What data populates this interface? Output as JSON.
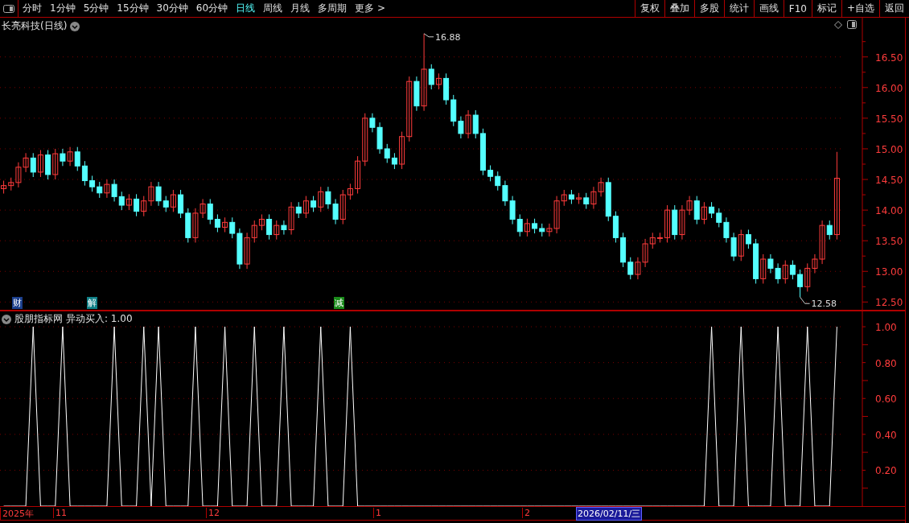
{
  "toolbar": {
    "periods": [
      {
        "label": "分时",
        "selected": false
      },
      {
        "label": "1分钟",
        "selected": false
      },
      {
        "label": "5分钟",
        "selected": false
      },
      {
        "label": "15分钟",
        "selected": false
      },
      {
        "label": "30分钟",
        "selected": false
      },
      {
        "label": "60分钟",
        "selected": false
      },
      {
        "label": "日线",
        "selected": true
      },
      {
        "label": "周线",
        "selected": false
      },
      {
        "label": "月线",
        "selected": false
      },
      {
        "label": "多周期",
        "selected": false
      },
      {
        "label": "更多 >",
        "selected": false
      }
    ],
    "buttons": [
      "复权",
      "叠加",
      "多股",
      "统计",
      "画线",
      "F10",
      "标记",
      "+自选",
      "返回"
    ]
  },
  "price_panel": {
    "title": "长亮科技(日线)",
    "chart_data": {
      "type": "candlestick",
      "grid": true,
      "ylim": [
        12.36,
        17.14
      ],
      "yticks": [
        {
          "value": 12.5,
          "label": "12.50"
        },
        {
          "value": 13,
          "label": "13.00"
        },
        {
          "value": 13.5,
          "label": "13.50"
        },
        {
          "value": 14,
          "label": "14.00"
        },
        {
          "value": 14.5,
          "label": "14.50"
        },
        {
          "value": 15,
          "label": "15.00"
        },
        {
          "value": 15.5,
          "label": "15.50"
        },
        {
          "value": 16,
          "label": "16.00"
        },
        {
          "value": 16.5,
          "label": "16.50"
        }
      ],
      "ohlc": [
        [
          14.35,
          14.48,
          14.27,
          14.4
        ],
        [
          14.4,
          14.53,
          14.32,
          14.45
        ],
        [
          14.45,
          14.78,
          14.37,
          14.7
        ],
        [
          14.7,
          14.93,
          14.62,
          14.85
        ],
        [
          14.85,
          14.93,
          14.54,
          14.62
        ],
        [
          14.62,
          14.98,
          14.54,
          14.9
        ],
        [
          14.9,
          14.98,
          14.5,
          14.58
        ],
        [
          14.58,
          15.0,
          14.5,
          14.92
        ],
        [
          14.92,
          15.0,
          14.72,
          14.8
        ],
        [
          14.8,
          15.03,
          14.72,
          14.95
        ],
        [
          14.95,
          15.03,
          14.64,
          14.72
        ],
        [
          14.72,
          14.8,
          14.4,
          14.48
        ],
        [
          14.48,
          14.56,
          14.3,
          14.38
        ],
        [
          14.38,
          14.46,
          14.2,
          14.28
        ],
        [
          14.28,
          14.5,
          14.2,
          14.42
        ],
        [
          14.42,
          14.5,
          14.14,
          14.22
        ],
        [
          14.22,
          14.3,
          14.0,
          14.08
        ],
        [
          14.08,
          14.26,
          14.0,
          14.18
        ],
        [
          14.18,
          14.26,
          13.9,
          13.98
        ],
        [
          13.98,
          14.23,
          13.9,
          14.15
        ],
        [
          14.15,
          14.46,
          14.07,
          14.38
        ],
        [
          14.38,
          14.46,
          14.07,
          14.15
        ],
        [
          14.15,
          14.23,
          13.97,
          14.05
        ],
        [
          14.05,
          14.33,
          13.97,
          14.25
        ],
        [
          14.25,
          14.33,
          13.87,
          13.95
        ],
        [
          13.95,
          14.03,
          13.47,
          13.55
        ],
        [
          13.55,
          14.03,
          13.47,
          13.95
        ],
        [
          13.95,
          14.18,
          13.87,
          14.1
        ],
        [
          14.1,
          14.18,
          13.77,
          13.85
        ],
        [
          13.85,
          13.93,
          13.64,
          13.72
        ],
        [
          13.72,
          13.88,
          13.64,
          13.8
        ],
        [
          13.8,
          13.88,
          13.54,
          13.62
        ],
        [
          13.62,
          13.7,
          13.04,
          13.12
        ],
        [
          13.12,
          13.63,
          13.04,
          13.55
        ],
        [
          13.55,
          13.83,
          13.47,
          13.75
        ],
        [
          13.75,
          13.93,
          13.67,
          13.85
        ],
        [
          13.85,
          13.93,
          13.52,
          13.6
        ],
        [
          13.6,
          13.83,
          13.52,
          13.75
        ],
        [
          13.75,
          13.83,
          13.6,
          13.68
        ],
        [
          13.68,
          14.13,
          13.6,
          14.05
        ],
        [
          14.05,
          14.13,
          13.87,
          13.95
        ],
        [
          13.95,
          14.23,
          13.87,
          14.15
        ],
        [
          14.15,
          14.23,
          13.97,
          14.05
        ],
        [
          14.05,
          14.38,
          13.97,
          14.3
        ],
        [
          14.3,
          14.38,
          14.02,
          14.1
        ],
        [
          14.1,
          14.18,
          13.77,
          13.85
        ],
        [
          13.85,
          14.33,
          13.77,
          14.25
        ],
        [
          14.25,
          14.43,
          14.17,
          14.35
        ],
        [
          14.35,
          14.88,
          14.27,
          14.8
        ],
        [
          14.8,
          15.58,
          14.72,
          15.5
        ],
        [
          15.5,
          15.58,
          15.27,
          15.35
        ],
        [
          15.35,
          15.43,
          14.92,
          15.0
        ],
        [
          15.0,
          15.08,
          14.77,
          14.85
        ],
        [
          14.85,
          14.93,
          14.67,
          14.75
        ],
        [
          14.75,
          15.28,
          14.67,
          15.2
        ],
        [
          15.2,
          16.18,
          15.12,
          16.1
        ],
        [
          16.1,
          16.18,
          15.62,
          15.7
        ],
        [
          15.7,
          16.88,
          15.62,
          16.3
        ],
        [
          16.3,
          16.38,
          15.97,
          16.05
        ],
        [
          16.05,
          16.23,
          15.97,
          16.15
        ],
        [
          16.15,
          16.23,
          15.72,
          15.8
        ],
        [
          15.8,
          15.88,
          15.37,
          15.45
        ],
        [
          15.45,
          15.53,
          15.17,
          15.25
        ],
        [
          15.25,
          15.63,
          15.17,
          15.55
        ],
        [
          15.55,
          15.63,
          15.17,
          15.25
        ],
        [
          15.25,
          15.33,
          14.57,
          14.65
        ],
        [
          14.65,
          14.73,
          14.47,
          14.55
        ],
        [
          14.55,
          14.63,
          14.32,
          14.4
        ],
        [
          14.4,
          14.48,
          14.07,
          14.15
        ],
        [
          14.15,
          14.23,
          13.77,
          13.85
        ],
        [
          13.85,
          13.93,
          13.57,
          13.65
        ],
        [
          13.65,
          13.86,
          13.57,
          13.78
        ],
        [
          13.78,
          13.86,
          13.62,
          13.7
        ],
        [
          13.7,
          13.78,
          13.57,
          13.65
        ],
        [
          13.65,
          13.78,
          13.57,
          13.7
        ],
        [
          13.7,
          14.23,
          13.62,
          14.15
        ],
        [
          14.15,
          14.33,
          14.07,
          14.25
        ],
        [
          14.25,
          14.33,
          14.1,
          14.18
        ],
        [
          14.18,
          14.28,
          14.1,
          14.2
        ],
        [
          14.2,
          14.28,
          14.02,
          14.1
        ],
        [
          14.1,
          14.38,
          14.02,
          14.3
        ],
        [
          14.3,
          14.53,
          14.22,
          14.45
        ],
        [
          14.45,
          14.53,
          13.82,
          13.9
        ],
        [
          13.9,
          13.98,
          13.47,
          13.55
        ],
        [
          13.55,
          13.63,
          13.07,
          13.15
        ],
        [
          13.15,
          13.23,
          12.87,
          12.95
        ],
        [
          12.95,
          13.23,
          12.87,
          13.15
        ],
        [
          13.15,
          13.53,
          13.07,
          13.45
        ],
        [
          13.45,
          13.63,
          13.37,
          13.55
        ],
        [
          13.55,
          13.63,
          13.47,
          13.55
        ],
        [
          13.55,
          14.08,
          13.47,
          14.0
        ],
        [
          14.0,
          14.08,
          13.52,
          13.6
        ],
        [
          13.6,
          14.08,
          13.52,
          14.0
        ],
        [
          14.0,
          14.23,
          13.92,
          14.15
        ],
        [
          14.15,
          14.23,
          13.77,
          13.85
        ],
        [
          13.85,
          14.13,
          13.77,
          14.05
        ],
        [
          14.05,
          14.13,
          13.87,
          13.95
        ],
        [
          13.95,
          14.03,
          13.72,
          13.8
        ],
        [
          13.8,
          13.88,
          13.47,
          13.55
        ],
        [
          13.55,
          13.63,
          13.17,
          13.25
        ],
        [
          13.25,
          13.68,
          13.17,
          13.6
        ],
        [
          13.6,
          13.68,
          13.37,
          13.45
        ],
        [
          13.45,
          13.53,
          12.8,
          12.88
        ],
        [
          12.88,
          13.28,
          12.8,
          13.2
        ],
        [
          13.2,
          13.28,
          12.97,
          13.05
        ],
        [
          13.05,
          13.13,
          12.8,
          12.88
        ],
        [
          12.88,
          13.18,
          12.8,
          13.1
        ],
        [
          13.1,
          13.18,
          12.87,
          12.95
        ],
        [
          12.95,
          13.03,
          12.58,
          12.75
        ],
        [
          12.75,
          13.13,
          12.67,
          13.05
        ],
        [
          13.05,
          13.28,
          12.97,
          13.2
        ],
        [
          13.2,
          13.83,
          13.12,
          13.75
        ],
        [
          13.75,
          13.83,
          13.52,
          13.6
        ],
        [
          13.6,
          14.95,
          13.52,
          14.52
        ]
      ],
      "annotations": [
        "16.88",
        "12.58"
      ]
    },
    "events": [
      {
        "label": "财",
        "color": "#1c3f8c"
      },
      {
        "label": "解",
        "color": "#0f7f86"
      },
      {
        "label": "减",
        "color": "#1a8a1a"
      }
    ]
  },
  "indicator_panel": {
    "title": "股朋指标网",
    "reading": "异动买入: 1.00",
    "chart_data": {
      "type": "line",
      "grid": true,
      "ylim": [
        0,
        1.09
      ],
      "yticks": [
        {
          "value": 0.2,
          "label": "0.20"
        },
        {
          "value": 0.4,
          "label": "0.40"
        },
        {
          "value": 0.6,
          "label": "0.60"
        },
        {
          "value": 0.8,
          "label": "0.80"
        },
        {
          "value": 1,
          "label": "1.00"
        }
      ],
      "series": [
        {
          "color": "#ffffff",
          "values": [
            0,
            0,
            0,
            0,
            1,
            0,
            0,
            0,
            1,
            0,
            0,
            0,
            0,
            0,
            0,
            1,
            0,
            0,
            0,
            1,
            0,
            1,
            0,
            0,
            0,
            0,
            1,
            0,
            0,
            0,
            1,
            0,
            0,
            0,
            1,
            0,
            0,
            0,
            1,
            0,
            0,
            0,
            0,
            1,
            0,
            0,
            0,
            1,
            0,
            0,
            0,
            0,
            0,
            0,
            0,
            0,
            0,
            0,
            0,
            0,
            0,
            0,
            0,
            0,
            0,
            0,
            0,
            0,
            0,
            0,
            0,
            0,
            0,
            0,
            0,
            0,
            0,
            0,
            0,
            0,
            0,
            0,
            0,
            0,
            0,
            0,
            0,
            0,
            0,
            0,
            0,
            0,
            0,
            0,
            0,
            0,
            1,
            0,
            0,
            0,
            1,
            0,
            0,
            0,
            0,
            1,
            0,
            0,
            0,
            1,
            0,
            0,
            0,
            1
          ]
        }
      ]
    }
  },
  "date_axis": [
    "2025年",
    "11",
    "12",
    "1",
    "2"
  ],
  "cursor_date": "2026/02/11/三"
}
